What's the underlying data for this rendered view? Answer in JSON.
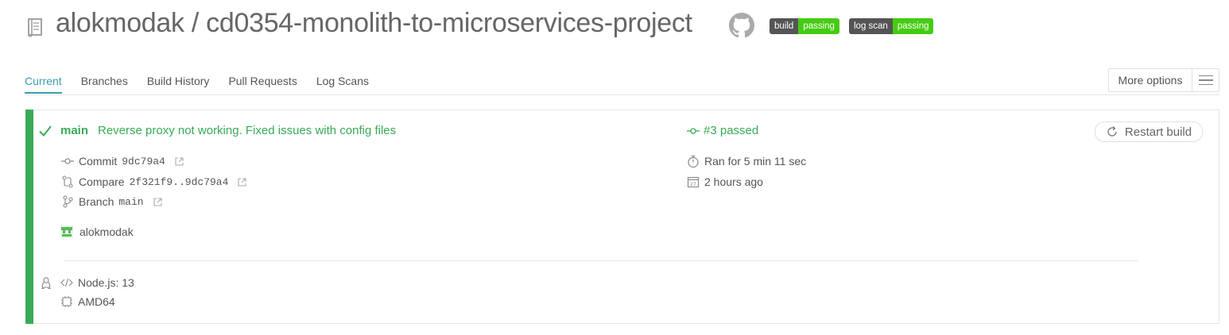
{
  "header": {
    "repo_title": "alokmodak / cd0354-monolith-to-microservices-project",
    "badges": [
      {
        "label": "build",
        "status": "passing"
      },
      {
        "label": "log scan",
        "status": "passing"
      }
    ]
  },
  "tabs": [
    "Current",
    "Branches",
    "Build History",
    "Pull Requests",
    "Log Scans"
  ],
  "more_options": "More options",
  "build": {
    "branch": "main",
    "message": "Reverse proxy not working. Fixed issues with config files",
    "number": "#3 passed",
    "restart": "Restart build",
    "commit_label": "Commit",
    "commit_hash": "9dc79a4",
    "compare_label": "Compare",
    "compare_range": "2f321f9..9dc79a4",
    "branch_label": "Branch",
    "branch_value": "main",
    "author": "alokmodak",
    "duration": "Ran for 5 min 11 sec",
    "time_ago": "2 hours ago",
    "language": "Node.js: 13",
    "arch": "AMD64"
  },
  "colors": {
    "passed": "#39aa56",
    "accent": "#3a9eac",
    "badge_dark": "#555555",
    "badge_green": "#44cc11"
  }
}
